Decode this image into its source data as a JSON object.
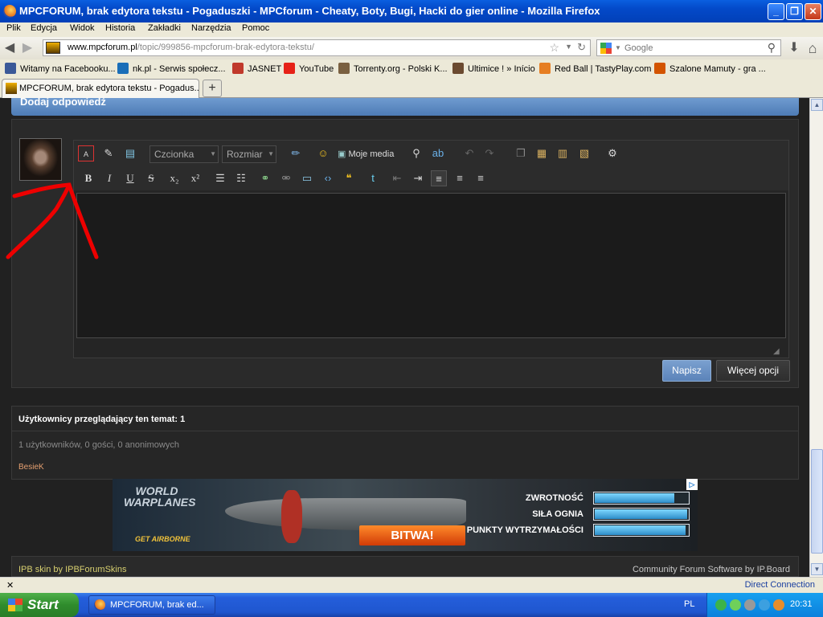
{
  "window": {
    "title": "MPCFORUM, brak edytora tekstu - Pogaduszki - MPCforum - Cheaty, Boty, Bugi, Hacki do gier online - Mozilla Firefox",
    "min_label": "_",
    "max_label": "❐",
    "close_label": "✕"
  },
  "menu": [
    "Plik",
    "Edycja",
    "Widok",
    "Historia",
    "Zakładki",
    "Narzędzia",
    "Pomoc"
  ],
  "nav": {
    "back": "◀",
    "forward": "▶",
    "url_host": "www.mpcforum.pl",
    "url_path": "/topic/999856-mpcforum-brak-edytora-tekstu/",
    "search_placeholder": "Google",
    "download": "⬇",
    "home": "⌂"
  },
  "bookmarks": [
    {
      "label": "Witamy na Facebooku...",
      "color": "#3b5998"
    },
    {
      "label": "nk.pl - Serwis społecz...",
      "color": "#1a6eb8"
    },
    {
      "label": "JASNET",
      "color": "#c0392b"
    },
    {
      "label": "YouTube",
      "color": "#e62117"
    },
    {
      "label": "Torrenty.org - Polski K...",
      "color": "#7a6040"
    },
    {
      "label": "Ultimice ! » Início",
      "color": "#6b4a30"
    },
    {
      "label": "Red Ball | TastyPlay.com",
      "color": "#e67e22"
    },
    {
      "label": "Szalone Mamuty - gra ...",
      "color": "#d35400"
    }
  ],
  "tab": {
    "title": "MPCFORUM, brak edytora tekstu - Pogadus...",
    "new_tab": "+"
  },
  "reply": {
    "header": "Dodaj odpowiedź",
    "font_select": "Czcionka",
    "size_select": "Rozmiar",
    "my_media": "Moje media",
    "submit": "Napisz",
    "more_options": "Więcej opcji"
  },
  "viewers": {
    "heading": "Użytkownicy przeglądający ten temat: 1",
    "counts": "1 użytkowników, 0 gości, 0 anonimowych",
    "user": "BesieK"
  },
  "ad": {
    "logo_line1": "WORLD",
    "logo_line2": "WARPLANES",
    "airborne": "GET AIRBORNE",
    "cta": "BITWA!",
    "stats": [
      {
        "label": "ZWROTNOŚĆ",
        "fill": 0.85
      },
      {
        "label": "SIŁA OGNIA",
        "fill": 0.99
      },
      {
        "label": "PUNKTY WYTRZYMAŁOŚCI",
        "fill": 0.97
      }
    ]
  },
  "footer": {
    "left": "IPB skin by IPBForumSkins",
    "right": "Community Forum Software by IP.Board"
  },
  "status": {
    "close": "✕",
    "right": "Direct Connection"
  },
  "taskbar": {
    "start": "Start",
    "item": "MPCFORUM, brak ed...",
    "lang": "PL",
    "clock": "20:31"
  }
}
